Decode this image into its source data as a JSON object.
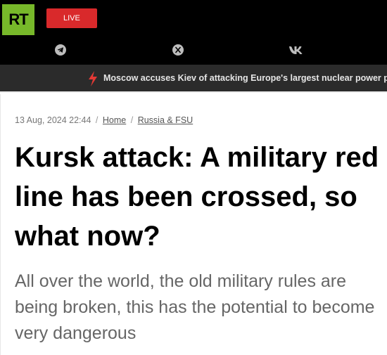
{
  "header": {
    "logo_text": "RT",
    "live_label": "LIVE",
    "social_icons": [
      "telegram-icon",
      "x-icon",
      "vk-icon"
    ],
    "colors": {
      "logo": "#77b82a",
      "live": "#d9292b",
      "bolt": "#e53935"
    }
  },
  "ticker": {
    "icon": "lightning-bolt-icon",
    "text": "Moscow accuses Kiev of attacking Europe's largest nuclear power pl"
  },
  "article": {
    "date": "13 Aug, 2024 22:44",
    "breadcrumb": [
      "Home",
      "Russia & FSU"
    ],
    "headline": "Kursk attack: A military red line has been crossed, so what now?",
    "summary": "All over the world, the old military rules are being broken, this has the potential to become very dangerous"
  }
}
